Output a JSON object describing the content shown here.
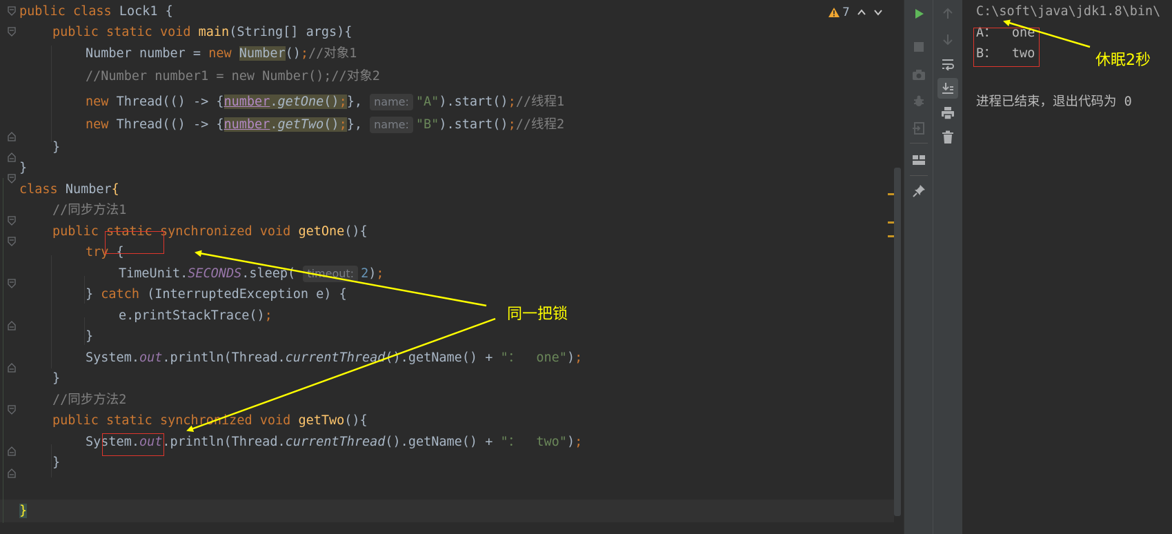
{
  "editor": {
    "warnings_count": "7",
    "lines": {
      "l1": {
        "kw1": "public",
        "kw2": "class",
        "name": "Lock1",
        "rest": " {"
      },
      "l2": {
        "kw1": "public",
        "kw2": "static",
        "kw3": "void",
        "fn": "main",
        "rest": "(String[] args){"
      },
      "l3": {
        "a": "Number number = ",
        "kw": "new",
        "cls": "Number",
        "b": "()",
        "semi": ";",
        "cmt": "//对象1"
      },
      "l4": {
        "cmt": "//Number number1 = new Number();//对象2"
      },
      "l5": {
        "kw": "new",
        "a": "Thread(() -> {",
        "obj": "number",
        "dot": ".",
        "m": "getOne",
        "b": "()",
        "semi": ";",
        "c": "},",
        "hint": "name:",
        "str": "\"A\"",
        "d": ").start()",
        "semi2": ";",
        "cmt": "//线程1"
      },
      "l6": {
        "kw": "new",
        "a": "Thread(() -> {",
        "obj": "number",
        "dot": ".",
        "m": "getTwo",
        "b": "()",
        "semi": ";",
        "c": "},",
        "hint": "name:",
        "str": "\"B\"",
        "d": ").start()",
        "semi2": ";",
        "cmt": "//线程2"
      },
      "l7": {
        "text": "}"
      },
      "l8": {
        "text": "}"
      },
      "l9": {
        "kw": "class",
        "name": "Number",
        "brace": "{"
      },
      "l10": {
        "cmt": "//同步方法1"
      },
      "l11": {
        "kw1": "public",
        "kw2": "static",
        "kw3": "synchronized",
        "kw4": "void",
        "fn": "getOne",
        "rest": "(){"
      },
      "l12": {
        "kw": "try",
        "rest": " {"
      },
      "l13": {
        "a": "TimeUnit.",
        "field": "SECONDS",
        "b": ".sleep(",
        "hint": "timeout:",
        "num": "2",
        "c": ")",
        "semi": ";"
      },
      "l14": {
        "a": "} ",
        "kw": "catch",
        "b": " (InterruptedException e) {"
      },
      "l15": {
        "a": "e.printStackTrace()",
        "semi": ";"
      },
      "l16": {
        "text": "}"
      },
      "l17": {
        "a": "System.",
        "field": "out",
        "b": ".println(Thread.",
        "ital": "currentThread",
        "c": "().getName() + ",
        "str": "\"：  one\"",
        "d": ")",
        "semi": ";"
      },
      "l18": {
        "text": "}"
      },
      "l19": {
        "cmt": "//同步方法2"
      },
      "l20": {
        "kw1": "public",
        "kw2": "static",
        "kw3": "synchronized",
        "kw4": "void",
        "fn": "getTwo",
        "rest": "(){"
      },
      "l21": {
        "a": "System.",
        "field": "out",
        "b": ".println(Thread.",
        "ital": "currentThread",
        "c": "().getName() + ",
        "str": "\"：  two\"",
        "d": ")",
        "semi": ";"
      },
      "l22": {
        "text": "}"
      },
      "l23": {
        "text": "}"
      }
    }
  },
  "console": {
    "path": "C:\\soft\\java\\jdk1.8\\bin\\",
    "out1": "A：  one",
    "out2": "B：  two",
    "exit": "进程已结束，退出代码为 0"
  },
  "annotations": {
    "same_lock": "同一把锁",
    "sleep": "休眠2秒"
  },
  "colors": {
    "keyword": "#cc7832",
    "function": "#ffc66d",
    "string": "#6a8759",
    "comment": "#808080",
    "field": "#9876aa",
    "annotation": "#ffff00",
    "box": "#e0362c"
  }
}
